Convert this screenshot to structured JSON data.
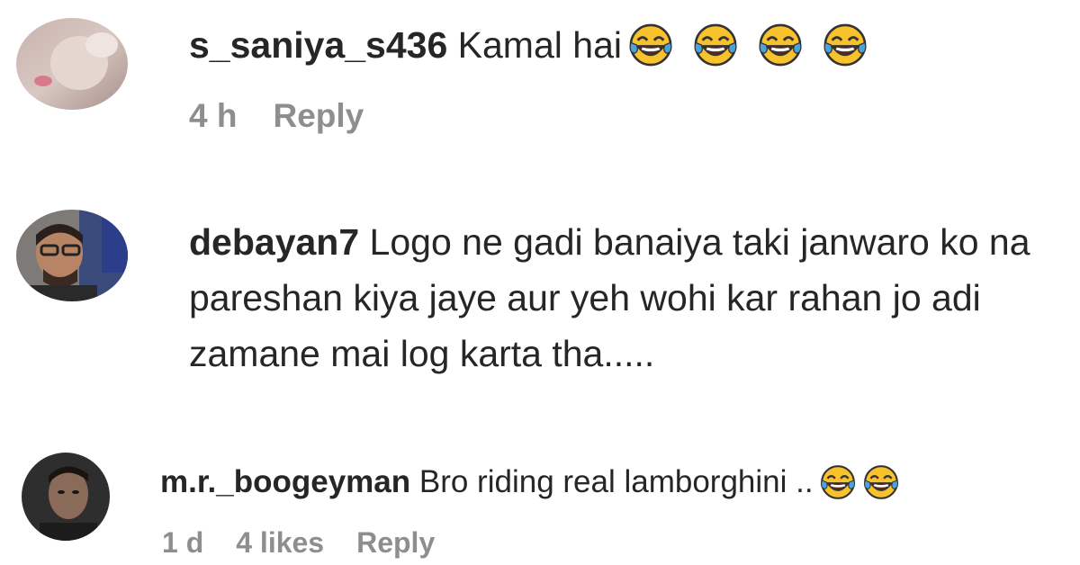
{
  "comments": [
    {
      "username": "s_saniya_s436",
      "text": " Kamal hai",
      "emojis": [
        "face-with-tears-of-joy-icon",
        "face-with-tears-of-joy-icon",
        "face-with-tears-of-joy-icon",
        "face-with-tears-of-joy-icon"
      ],
      "time": "4 h",
      "reply_label": "Reply"
    },
    {
      "username": "debayan7",
      "text": " Logo ne gadi banaiya taki janwaro ko na pareshan kiya jaye aur yeh wohi kar rahan jo adi zamane mai log karta tha....."
    },
    {
      "username": "m.r._boogeyman",
      "text": " Bro riding real lamborghini ..",
      "emojis": [
        "face-with-tears-of-joy-icon",
        "face-with-tears-of-joy-icon"
      ],
      "time": "1 d",
      "likes": "4 likes",
      "reply_label": "Reply"
    }
  ],
  "colors": {
    "text": "#262626",
    "meta": "#8e8e8e",
    "emoji_face": "#f7c22b",
    "emoji_tear": "#4aa3df"
  }
}
